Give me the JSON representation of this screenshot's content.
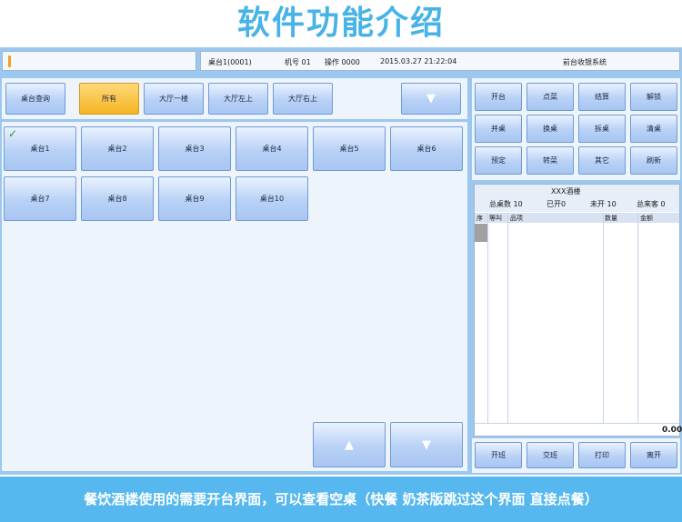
{
  "page_title": "软件功能介绍",
  "status": {
    "table": "桌台1(0001)",
    "machine": "机号 01",
    "operator": "操作 0000",
    "datetime": "2015.03.27 21:22:04",
    "system": "前台收银系统"
  },
  "filter": {
    "search_label": "桌台查询",
    "tabs": [
      "所有",
      "大厅一楼",
      "大厅左上",
      "大厅右上"
    ],
    "active_tab": "所有",
    "down_arrow": "▼"
  },
  "tables": [
    "桌台1",
    "桌台2",
    "桌台3",
    "桌台4",
    "桌台5",
    "桌台6",
    "桌台7",
    "桌台8",
    "桌台9",
    "桌台10"
  ],
  "pager": {
    "up": "▲",
    "down": "▼"
  },
  "functions": [
    "开台",
    "点菜",
    "结算",
    "解锁",
    "并桌",
    "换桌",
    "拆桌",
    "清桌",
    "预定",
    "转菜",
    "其它",
    "刷新"
  ],
  "info": {
    "restaurant": "XXX酒楼",
    "total": "总桌数 10",
    "opened": "已开0",
    "unopened": "未开 10",
    "guests": "总来客 0",
    "columns": [
      "序",
      "等叫",
      "品项",
      "数量",
      "金额"
    ],
    "amount": "0.00"
  },
  "shift_buttons": [
    "开班",
    "交班",
    "打印",
    "离开"
  ],
  "banner": "餐饮酒楼使用的需要开台界面，可以查看空桌（快餐 奶茶版跳过这个界面 直接点餐）",
  "colors": {
    "title": "#47b3e6",
    "frame": "#9cc7ee",
    "banner": "#56b8ee",
    "active_tab": "#f4b422"
  }
}
